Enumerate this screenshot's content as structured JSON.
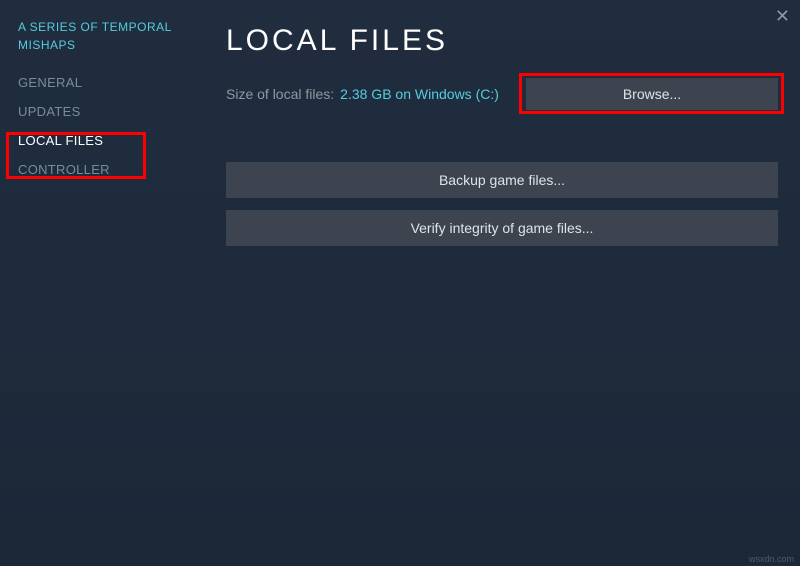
{
  "sidebar": {
    "game_title": "A SERIES OF TEMPORAL MISHAPS",
    "items": [
      {
        "label": "GENERAL"
      },
      {
        "label": "UPDATES"
      },
      {
        "label": "LOCAL FILES"
      },
      {
        "label": "CONTROLLER"
      }
    ],
    "active_index": 2
  },
  "main": {
    "title": "LOCAL FILES",
    "size_label": "Size of local files:",
    "size_value": "2.38 GB on Windows (C:)",
    "browse_button": "Browse...",
    "backup_button": "Backup game files...",
    "verify_button": "Verify integrity of game files..."
  },
  "watermark": "wsxdn.com"
}
